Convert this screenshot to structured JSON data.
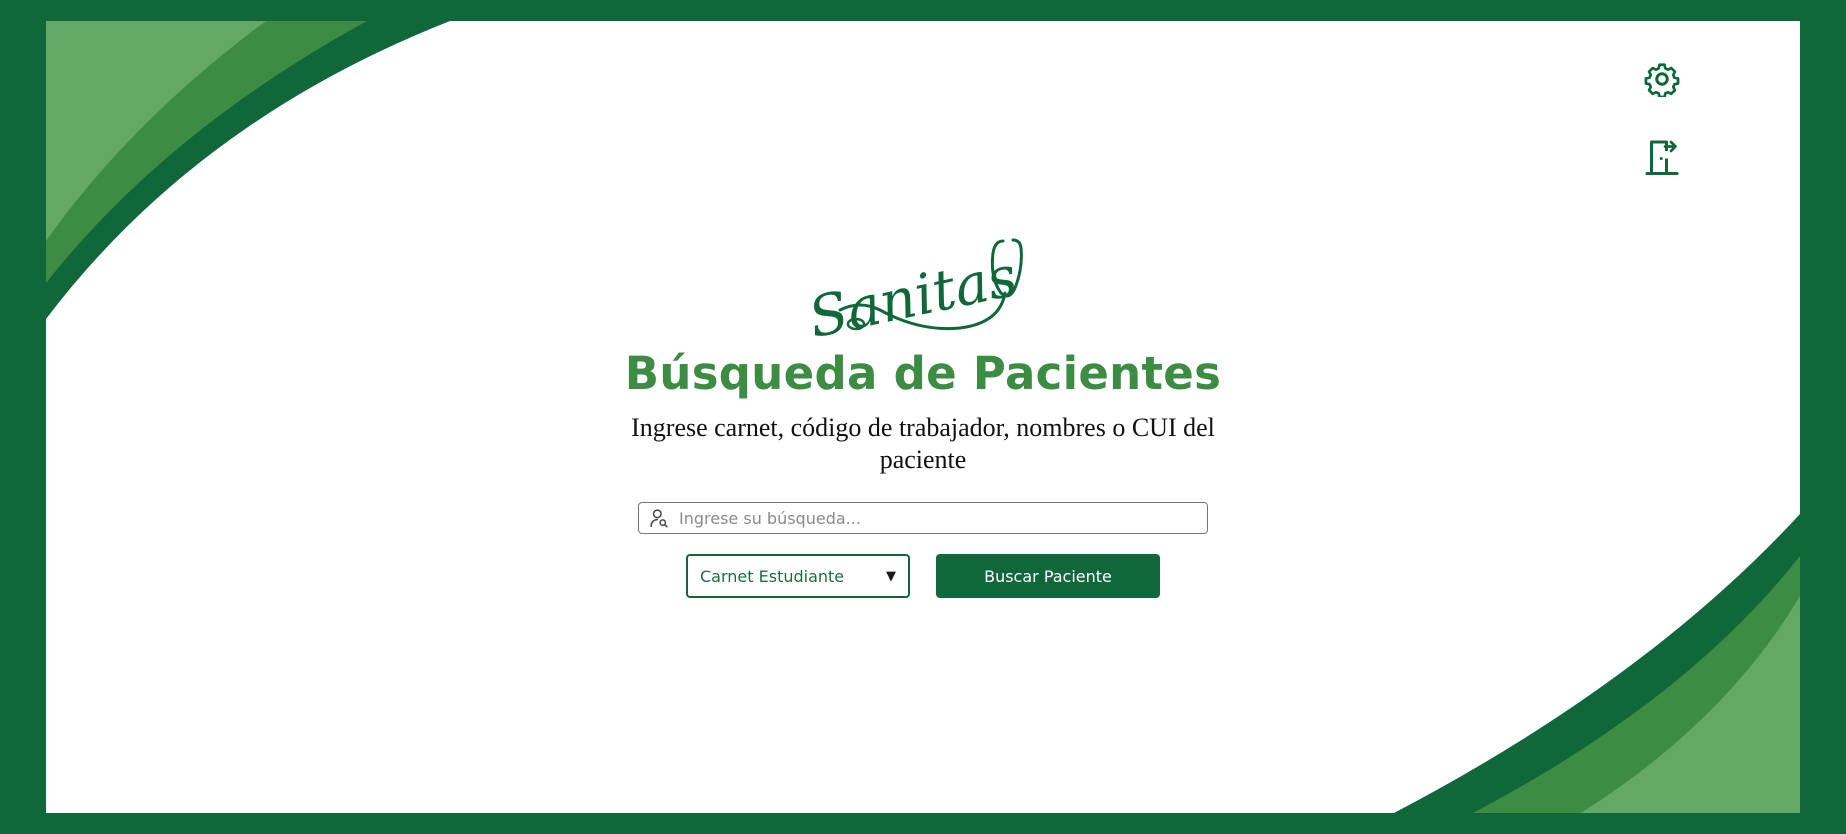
{
  "app": {
    "logo_text": "Sanitas"
  },
  "header": {
    "settings_icon": "gear-icon",
    "logout_icon": "exit-door-icon"
  },
  "main": {
    "title": "Búsqueda de Pacientes",
    "subtitle": "Ingrese carnet, código de trabajador, nombres o CUI del paciente",
    "search": {
      "placeholder": "Ingrese su búsqueda...",
      "value": "",
      "icon": "user-search-icon"
    },
    "filter": {
      "selected": "Carnet Estudiante",
      "icon": "dropdown-triangle-icon",
      "arrow_glyph": "▼"
    },
    "submit_label": "Buscar Paciente"
  },
  "colors": {
    "brand_dark": "#10683a",
    "brand_mid": "#3c8c43",
    "brand_light": "#63a965",
    "background": "#ffffff"
  }
}
